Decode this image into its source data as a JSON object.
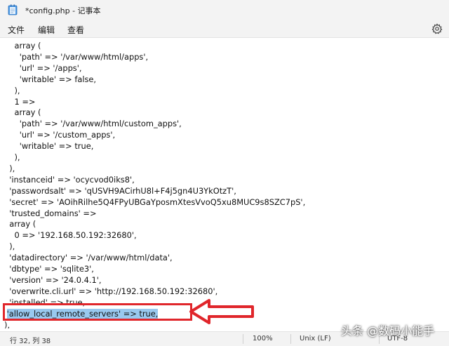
{
  "window": {
    "title": "*config.php - 记事本",
    "icon": "notepad-icon"
  },
  "menu": {
    "items": [
      "文件",
      "编辑",
      "查看"
    ],
    "settings_icon": "gear-icon"
  },
  "editor": {
    "lines": [
      "    array (",
      "      'path' => '/var/www/html/apps',",
      "      'url' => '/apps',",
      "      'writable' => false,",
      "    ),",
      "    1 =>",
      "    array (",
      "      'path' => '/var/www/html/custom_apps',",
      "      'url' => '/custom_apps',",
      "      'writable' => true,",
      "    ),",
      "  ),",
      "  'instanceid' => 'ocycvod0iks8',",
      "  'passwordsalt' => 'qUSVH9ACirhU8l+F4j5gn4U3YkOtzT',",
      "  'secret' => 'AOihRilhe5Q4FPyUBGaYposmXtesVvoQ5xu8MUC9s8SZC7pS',",
      "  'trusted_domains' =>",
      "  array (",
      "    0 => '192.168.50.192:32680',",
      "  ),",
      "  'datadirectory' => '/var/www/html/data',",
      "  'dbtype' => 'sqlite3',",
      "  'version' => '24.0.4.1',",
      "  'overwrite.cli.url' => 'http://192.168.50.192:32680',",
      "  'installed' => true,",
      " 'allow_local_remote_servers' => true,",
      "),"
    ],
    "selected_line_index": 24
  },
  "annotation": {
    "color": "#e0262b"
  },
  "status": {
    "position": "行 32, 列 38",
    "zoom": "100%",
    "line_ending": "Unix (LF)",
    "encoding": "UTF-8"
  },
  "watermark": {
    "text": "头条 @数码小能手"
  }
}
